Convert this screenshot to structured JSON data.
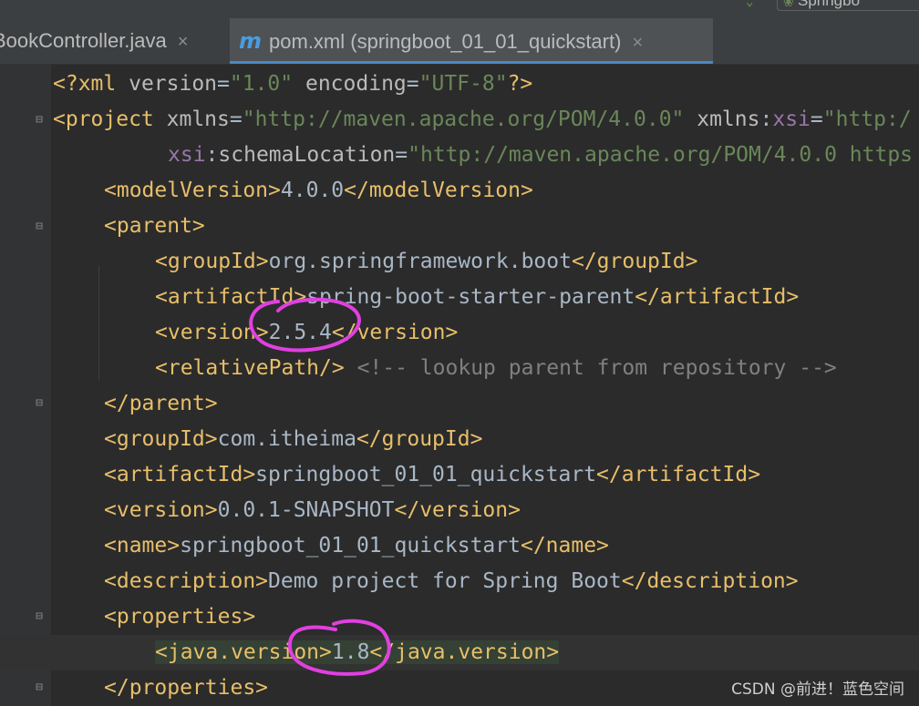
{
  "top": {
    "run_config_label": "Springbo"
  },
  "tabs": [
    {
      "label": "BookController.java",
      "close": "×",
      "active": false
    },
    {
      "icon": "m",
      "label": "pom.xml (springboot_01_01_quickstart)",
      "close": "×",
      "active": true
    }
  ],
  "code": {
    "l1": {
      "open": "<?xml ",
      "a1": "version",
      "eq1": "=",
      "v1": "\"1.0\"",
      "a2": " encoding",
      "eq2": "=",
      "v2": "\"UTF-8\"",
      "close": "?>"
    },
    "l2": {
      "open": "<project ",
      "a1": "xmlns",
      "eq1": "=",
      "v1": "\"http://maven.apache.org/POM/4.0.0\"",
      "a2": " xmlns",
      "colon": ":",
      "ns": "xsi",
      "eq2": "=",
      "v2": "\"http:/"
    },
    "l3": {
      "ns": "xsi",
      "colon": ":",
      "a1": "schemaLocation",
      "eq1": "=",
      "v1": "\"http://maven.apache.org/POM/4.0.0 https"
    },
    "l4": {
      "open": "<modelVersion>",
      "text": "4.0.0",
      "close": "</modelVersion>"
    },
    "l5": {
      "open": "<parent>"
    },
    "l6": {
      "open": "<groupId>",
      "text": "org.springframework.boot",
      "close": "</groupId>"
    },
    "l7": {
      "open": "<artifactId>",
      "text": "spring-boot-starter-parent",
      "close": "</artifactId>"
    },
    "l8": {
      "open": "<version>",
      "text": "2.5.4",
      "close": "</version>"
    },
    "l9": {
      "open": "<relativePath/>",
      "comment": " <!-- lookup parent from repository -->"
    },
    "l10": {
      "close": "</parent>"
    },
    "l11": {
      "open": "<groupId>",
      "text": "com.itheima",
      "close": "</groupId>"
    },
    "l12": {
      "open": "<artifactId>",
      "text": "springboot_01_01_quickstart",
      "close": "</artifactId>"
    },
    "l13": {
      "open": "<version>",
      "text": "0.0.1-SNAPSHOT",
      "close": "</version>"
    },
    "l14": {
      "open": "<name>",
      "text": "springboot_01_01_quickstart",
      "close": "</name>"
    },
    "l15": {
      "open": "<description>",
      "text": "Demo project for Spring Boot",
      "close": "</description>"
    },
    "l16": {
      "open": "<properties>"
    },
    "l17": {
      "open": "<java.version>",
      "text": "1.8",
      "close": "</java.version>"
    },
    "l18": {
      "close": "</properties>"
    }
  },
  "colors": {
    "tag": "#e8bf6a",
    "string": "#6a8759",
    "annotation": "#e040e0",
    "background": "#2b2b2b"
  },
  "watermark": "CSDN @前进！蓝色空间"
}
